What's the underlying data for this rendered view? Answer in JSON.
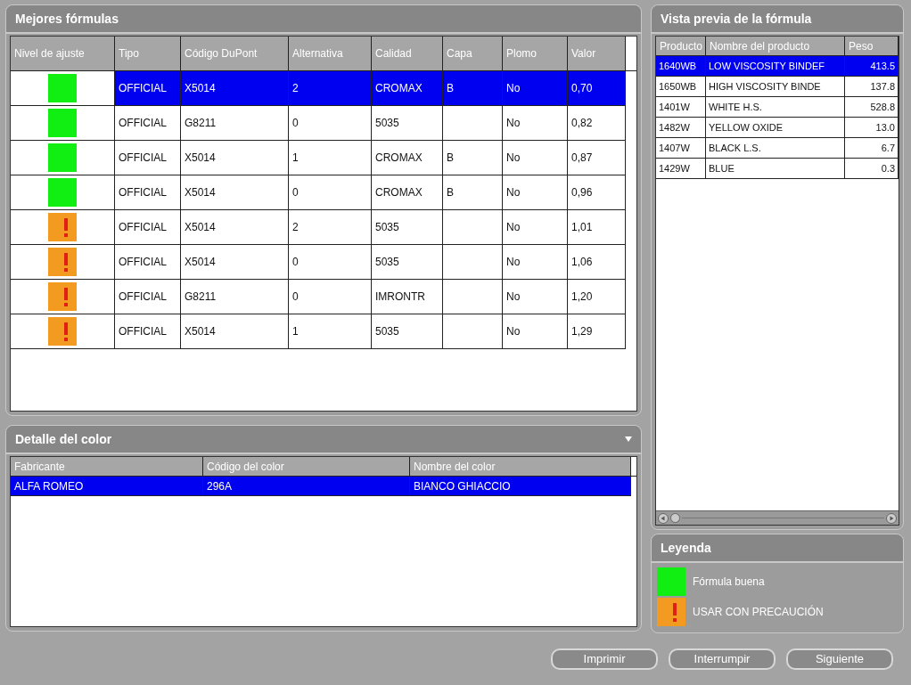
{
  "best_formulas": {
    "title": "Mejores fórmulas",
    "columns": [
      "Nivel de ajuste",
      "Tipo",
      "Código DuPont",
      "Alternativa",
      "Calidad",
      "Capa",
      "Plomo",
      "Valor"
    ],
    "rows": [
      {
        "kind": "good",
        "selected": true,
        "cells": [
          "",
          "OFFICIAL",
          "X5014",
          "2",
          "CROMAX",
          "B",
          "No",
          "0,70"
        ]
      },
      {
        "kind": "good",
        "selected": false,
        "cells": [
          "",
          "OFFICIAL",
          "G8211",
          "0",
          "5035",
          "",
          "No",
          "0,82"
        ]
      },
      {
        "kind": "good",
        "selected": false,
        "cells": [
          "",
          "OFFICIAL",
          "X5014",
          "1",
          "CROMAX",
          "B",
          "No",
          "0,87"
        ]
      },
      {
        "kind": "good",
        "selected": false,
        "cells": [
          "",
          "OFFICIAL",
          "X5014",
          "0",
          "CROMAX",
          "B",
          "No",
          "0,96"
        ]
      },
      {
        "kind": "caution",
        "selected": false,
        "cells": [
          "",
          "OFFICIAL",
          "X5014",
          "2",
          "5035",
          "",
          "No",
          "1,01"
        ]
      },
      {
        "kind": "caution",
        "selected": false,
        "cells": [
          "",
          "OFFICIAL",
          "X5014",
          "0",
          "5035",
          "",
          "No",
          "1,06"
        ]
      },
      {
        "kind": "caution",
        "selected": false,
        "cells": [
          "",
          "OFFICIAL",
          "G8211",
          "0",
          "IMRONTR",
          "",
          "No",
          "1,20"
        ]
      },
      {
        "kind": "caution",
        "selected": false,
        "cells": [
          "",
          "OFFICIAL",
          "X5014",
          "1",
          "5035",
          "",
          "No",
          "1,29"
        ]
      }
    ]
  },
  "color_detail": {
    "title": "Detalle del color",
    "columns": [
      "Fabricante",
      "Código del color",
      "Nombre del color"
    ],
    "rows": [
      {
        "selected": true,
        "cells": [
          "ALFA ROMEO",
          "296A",
          "BIANCO GHIACCIO"
        ]
      }
    ]
  },
  "preview": {
    "title": "Vista previa de la fórmula",
    "columns": [
      "Producto",
      "Nombre del producto",
      "Peso"
    ],
    "rows": [
      {
        "selected": true,
        "cells": [
          "1640WB",
          "LOW VISCOSITY BINDEF",
          "413.5"
        ]
      },
      {
        "selected": false,
        "cells": [
          "1650WB",
          "HIGH VISCOSITY BINDE",
          "137.8"
        ]
      },
      {
        "selected": false,
        "cells": [
          "1401W",
          "WHITE H.S.",
          "528.8"
        ]
      },
      {
        "selected": false,
        "cells": [
          "1482W",
          "YELLOW OXIDE",
          "13.0"
        ]
      },
      {
        "selected": false,
        "cells": [
          "1407W",
          "BLACK L.S.",
          "6.7"
        ]
      },
      {
        "selected": false,
        "cells": [
          "1429W",
          "BLUE",
          "0.3"
        ]
      }
    ]
  },
  "legend": {
    "title": "Leyenda",
    "items": [
      {
        "kind": "good",
        "label": "Fórmula buena"
      },
      {
        "kind": "caution",
        "label": "USAR CON PRECAUCIÓN"
      }
    ]
  },
  "buttons": [
    "Imprimir",
    "Interrumpir",
    "Siguiente"
  ]
}
